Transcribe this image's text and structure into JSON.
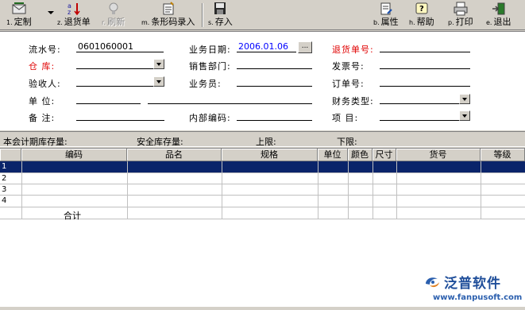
{
  "toolbar": {
    "customize": {
      "key": "1.",
      "label": "定制"
    },
    "return_doc": {
      "key": "z.",
      "label": "退货单"
    },
    "refresh": {
      "key": "r.",
      "label": "刷新"
    },
    "barcode": {
      "key": "m.",
      "label": "条形码录入"
    },
    "save": {
      "key": "s.",
      "label": "存入"
    },
    "properties": {
      "key": "b.",
      "label": "属性"
    },
    "help": {
      "key": "h.",
      "label": "帮助"
    },
    "print": {
      "key": "p.",
      "label": "打印"
    },
    "exit": {
      "key": "e.",
      "label": "退出"
    }
  },
  "form": {
    "serial_label": "流水号:",
    "serial_value": "0601060001",
    "biz_date_label": "业务日期:",
    "biz_date_value": "2006.01.06",
    "dots_label": "...",
    "return_no_label": "退货单号:",
    "warehouse_label": "仓    库:",
    "sales_dept_label": "销售部门:",
    "invoice_label": "发票号:",
    "inspector_label": "验收人:",
    "clerk_label": "业务员:",
    "order_no_label": "订单号:",
    "unit_label": "单    位:",
    "finance_type_label": "财务类型:",
    "remark_label": "备    注:",
    "internal_code_label": "内部编码:",
    "project_label": "项    目:"
  },
  "stock": {
    "period_stock": "本会计期库存量:",
    "safety_stock": "安全库存量:",
    "upper": "上限:",
    "lower": "下限:"
  },
  "grid": {
    "columns": [
      "编码",
      "品名",
      "规格",
      "单位",
      "颜色",
      "尺寸",
      "货号",
      "等级"
    ],
    "rows": [
      "1",
      "2",
      "3",
      "4"
    ],
    "total_label": "合计"
  },
  "watermark": {
    "brand": "泛普软件",
    "url": "www.fanpusoft.com"
  },
  "colors": {
    "selection": "#0a246a",
    "required_label": "#e00000",
    "date_value": "#0000ff"
  }
}
